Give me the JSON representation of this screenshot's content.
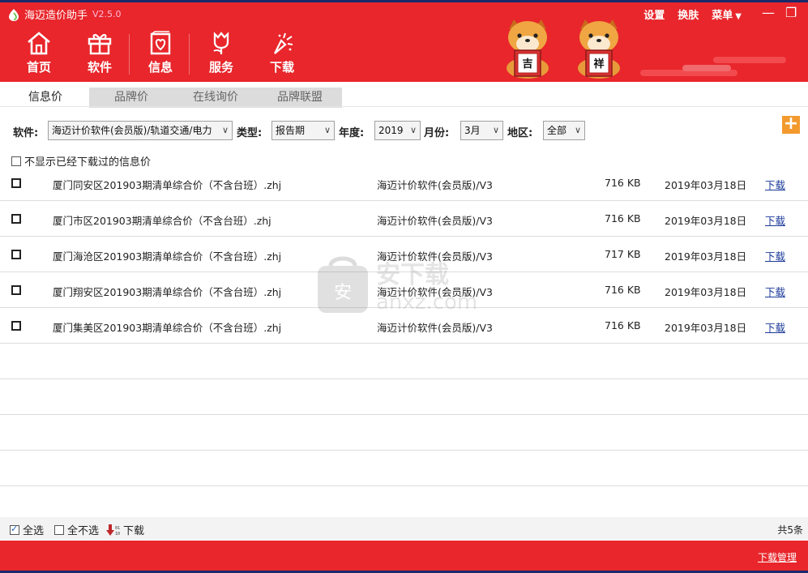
{
  "app": {
    "title": "海迈造价助手",
    "version": "V2.5.0"
  },
  "nav": [
    {
      "label": "首页",
      "icon": "home-icon"
    },
    {
      "label": "软件",
      "icon": "gift-icon"
    },
    {
      "label": "信息",
      "icon": "heart-card-icon"
    },
    {
      "label": "服务",
      "icon": "tulip-icon"
    },
    {
      "label": "下载",
      "icon": "fireworks-icon"
    }
  ],
  "top_links": {
    "settings": "设置",
    "skin": "换肤",
    "menu": "菜单"
  },
  "window": {
    "minimize": "—",
    "restore": "❐",
    "close": "✕"
  },
  "mascots": {
    "left_sign": "吉",
    "right_sign": "祥"
  },
  "tabs": [
    "信息价",
    "品牌价",
    "在线询价",
    "品牌联盟"
  ],
  "filters": {
    "software_label": "软件:",
    "software_value": "海迈计价软件(会员版)/轨道交通/电力",
    "type_label": "类型:",
    "type_value": "报告期",
    "year_label": "年度:",
    "year_value": "2019",
    "month_label": "月份:",
    "month_value": "3月",
    "region_label": "地区:",
    "region_value": "全部"
  },
  "hide_downloaded_label": "不显示已经下载过的信息价",
  "rows": [
    {
      "name": "厦门同安区201903期清单综合价（不含台班）.zhj",
      "software": "海迈计价软件(会员版)/V3",
      "size": "716 KB",
      "date": "2019年03月18日",
      "action": "下载"
    },
    {
      "name": "厦门市区201903期清单综合价（不含台班）.zhj",
      "software": "海迈计价软件(会员版)/V3",
      "size": "716 KB",
      "date": "2019年03月18日",
      "action": "下载"
    },
    {
      "name": "厦门海沧区201903期清单综合价（不含台班）.zhj",
      "software": "海迈计价软件(会员版)/V3",
      "size": "717 KB",
      "date": "2019年03月18日",
      "action": "下载"
    },
    {
      "name": "厦门翔安区201903期清单综合价（不含台班）.zhj",
      "software": "海迈计价软件(会员版)/V3",
      "size": "716 KB",
      "date": "2019年03月18日",
      "action": "下载"
    },
    {
      "name": "厦门集美区201903期清单综合价（不含台班）.zhj",
      "software": "海迈计价软件(会员版)/V3",
      "size": "716 KB",
      "date": "2019年03月18日",
      "action": "下载"
    }
  ],
  "footer": {
    "select_all": "全选",
    "select_none": "全不选",
    "download": "下载",
    "total": "共5条",
    "download_manager": "下载管理"
  },
  "watermark": {
    "text": "安下载",
    "sub": "anxz.com"
  },
  "colors": {
    "brand_red": "#e8262b",
    "accent_orange": "#f39a2e",
    "link_blue": "#1a3a9a"
  }
}
